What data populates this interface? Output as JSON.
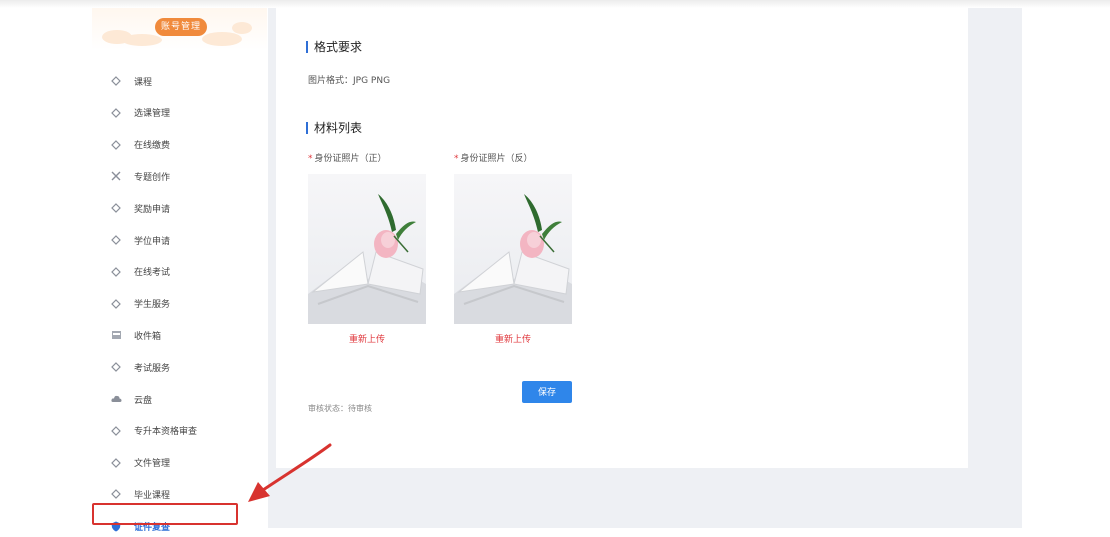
{
  "sidebar": {
    "badge": "账号管理",
    "items": [
      {
        "label": "课程",
        "icon": "diamond-icon"
      },
      {
        "label": "选课管理",
        "icon": "diamond-icon"
      },
      {
        "label": "在线缴费",
        "icon": "diamond-icon"
      },
      {
        "label": "专题创作",
        "icon": "cross-icon"
      },
      {
        "label": "奖励申请",
        "icon": "diamond-icon"
      },
      {
        "label": "学位申请",
        "icon": "diamond-icon"
      },
      {
        "label": "在线考试",
        "icon": "diamond-icon"
      },
      {
        "label": "学生服务",
        "icon": "diamond-icon"
      },
      {
        "label": "收件箱",
        "icon": "inbox-icon"
      },
      {
        "label": "考试服务",
        "icon": "diamond-icon"
      },
      {
        "label": "云盘",
        "icon": "cloud-icon"
      },
      {
        "label": "专升本资格审查",
        "icon": "diamond-icon"
      },
      {
        "label": "文件管理",
        "icon": "diamond-icon"
      },
      {
        "label": "毕业课程",
        "icon": "diamond-icon"
      },
      {
        "label": "证件复查",
        "icon": "shield-icon"
      }
    ],
    "active_index": 14
  },
  "main": {
    "format_title": "格式要求",
    "format_text": "图片格式：JPG PNG",
    "materials_title": "材料列表",
    "uploads": [
      {
        "label": "身份证照片（正）",
        "reupload": "重新上传"
      },
      {
        "label": "身份证照片（反）",
        "reupload": "重新上传"
      }
    ],
    "save_label": "保存",
    "status_text": "审核状态：待审核"
  },
  "colors": {
    "accent": "#2f6fd6",
    "required": "#e0393e",
    "badge": "#f08a3c",
    "highlight": "#d8332f"
  }
}
